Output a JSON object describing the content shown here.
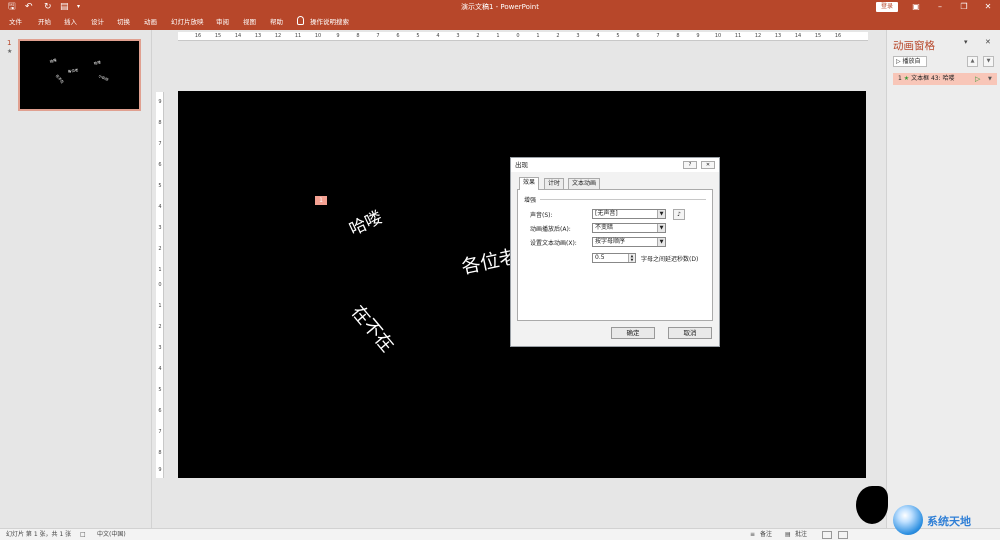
{
  "window": {
    "title": "演示文稿1 - PowerPoint",
    "login_label": "登录",
    "quick_access_icons": [
      "save-icon",
      "undo-icon",
      "redo-icon",
      "present-icon",
      "customize-icon"
    ]
  },
  "ribbon": {
    "tabs": [
      "文件",
      "开始",
      "插入",
      "设计",
      "切换",
      "动画",
      "幻灯片放映",
      "审阅",
      "视图",
      "帮助"
    ],
    "tell_me": "操作说明搜索"
  },
  "thumbnails": {
    "slide_number": "1",
    "transition_marker": "★",
    "words": [
      "哈喽",
      "各位老",
      "在不在",
      "哈喽",
      "小伙伴"
    ]
  },
  "ruler": {
    "horizontal": [
      "16",
      "15",
      "14",
      "13",
      "12",
      "11",
      "10",
      "9",
      "8",
      "7",
      "6",
      "5",
      "4",
      "3",
      "2",
      "1",
      "0",
      "1",
      "2",
      "3",
      "4",
      "5",
      "6",
      "7",
      "8",
      "9",
      "10",
      "11",
      "12",
      "13",
      "14",
      "15",
      "16"
    ],
    "vertical": [
      "9",
      "8",
      "7",
      "6",
      "5",
      "4",
      "3",
      "2",
      "1",
      "0",
      "1",
      "2",
      "3",
      "4",
      "5",
      "6",
      "7",
      "8",
      "9"
    ]
  },
  "slide": {
    "animation_tag": "1",
    "words": [
      "哈喽",
      "各位老",
      "在不在"
    ]
  },
  "dialog": {
    "title": "出现",
    "help_btn": "?",
    "close_btn": "✕",
    "tabs": [
      "效果",
      "计时",
      "文本动画"
    ],
    "section": "增强",
    "rows": [
      {
        "label": "声音(S):",
        "value": "[无声音]"
      },
      {
        "label": "动画播放后(A):",
        "value": "不变暗"
      },
      {
        "label": "设置文本动画(X):",
        "value": "按字母顺序"
      }
    ],
    "delay_value": "0.5",
    "delay_label": "字母之间延迟秒数(D)",
    "ok": "确定",
    "cancel": "取消"
  },
  "animation_pane": {
    "title": "动画窗格",
    "play_label": "播放自",
    "item": {
      "index": "1",
      "label": "文本框 43: 哈喽"
    }
  },
  "statusbar": {
    "slide_info": "幻灯片 第 1 张，共 1 张",
    "language": "中文(中国)",
    "notes": "备注",
    "comments": "批注"
  },
  "watermark": {
    "text": "系统天地"
  },
  "colors": {
    "accent": "#b7472a",
    "selected_item": "#f8c6b8",
    "slide_bg": "#000000"
  }
}
